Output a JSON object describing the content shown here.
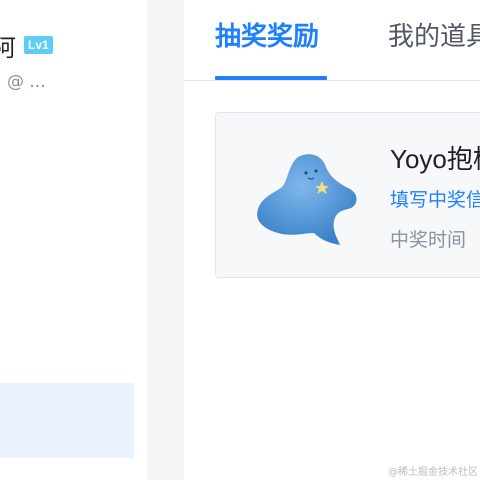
{
  "sidebar": {
    "username": "阿",
    "level_badge": "Lv1",
    "handle": "@ ..."
  },
  "tabs": [
    {
      "label": "抽奖奖励",
      "active": true
    },
    {
      "label": "我的道具",
      "active": false
    }
  ],
  "prize": {
    "name": "Yoyo抱枕",
    "link_text": "填写中奖信息",
    "time_label": "中奖时间"
  },
  "watermark": "@稀土掘金技术社区",
  "colors": {
    "accent": "#1e80ff",
    "level_badge": "#5ecdf6",
    "sidebar_active": "#eaf2ff"
  }
}
